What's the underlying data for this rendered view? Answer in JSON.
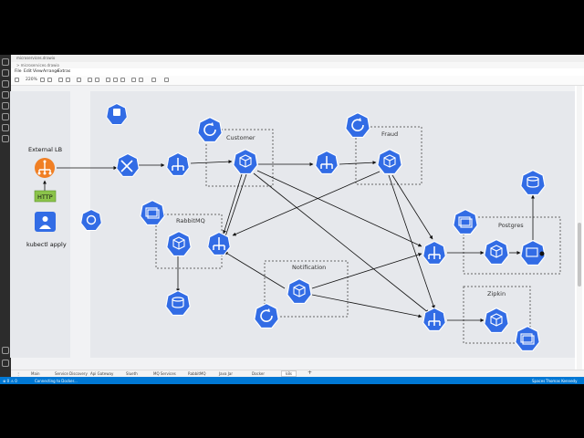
{
  "window": {
    "tab_title": "microservices.drawio",
    "path": "> microservices.drawio"
  },
  "menu": [
    "File",
    "Edit",
    "View",
    "Arrange",
    "Extras"
  ],
  "toolbar": {
    "zoom": "220%"
  },
  "diagram": {
    "labels": {
      "external_lb": "External LB",
      "http": "HTTP",
      "kubectl": "kubectl apply",
      "customer": "Customer",
      "fraud": "Fraud",
      "rabbitmq": "RabbitMQ",
      "notification": "Notification",
      "postgres": "Postgres",
      "zipkin": "Zipkin"
    }
  },
  "bottom_tabs": [
    "Main",
    "Service Discovery",
    "Api Gateway",
    "Slueth",
    "MQ Services",
    "RabbitMQ",
    "Java Jar",
    "Docker",
    "k8s"
  ],
  "status": {
    "left": "Connecting to Docker...",
    "right_user": "Thomas Kennedy",
    "right_fmt": "Spaces"
  },
  "colors": {
    "k8s_blue": "#326ce5",
    "lb_orange": "#f07f24",
    "http_green": "#8bc34a",
    "status_blue": "#0078d4"
  }
}
